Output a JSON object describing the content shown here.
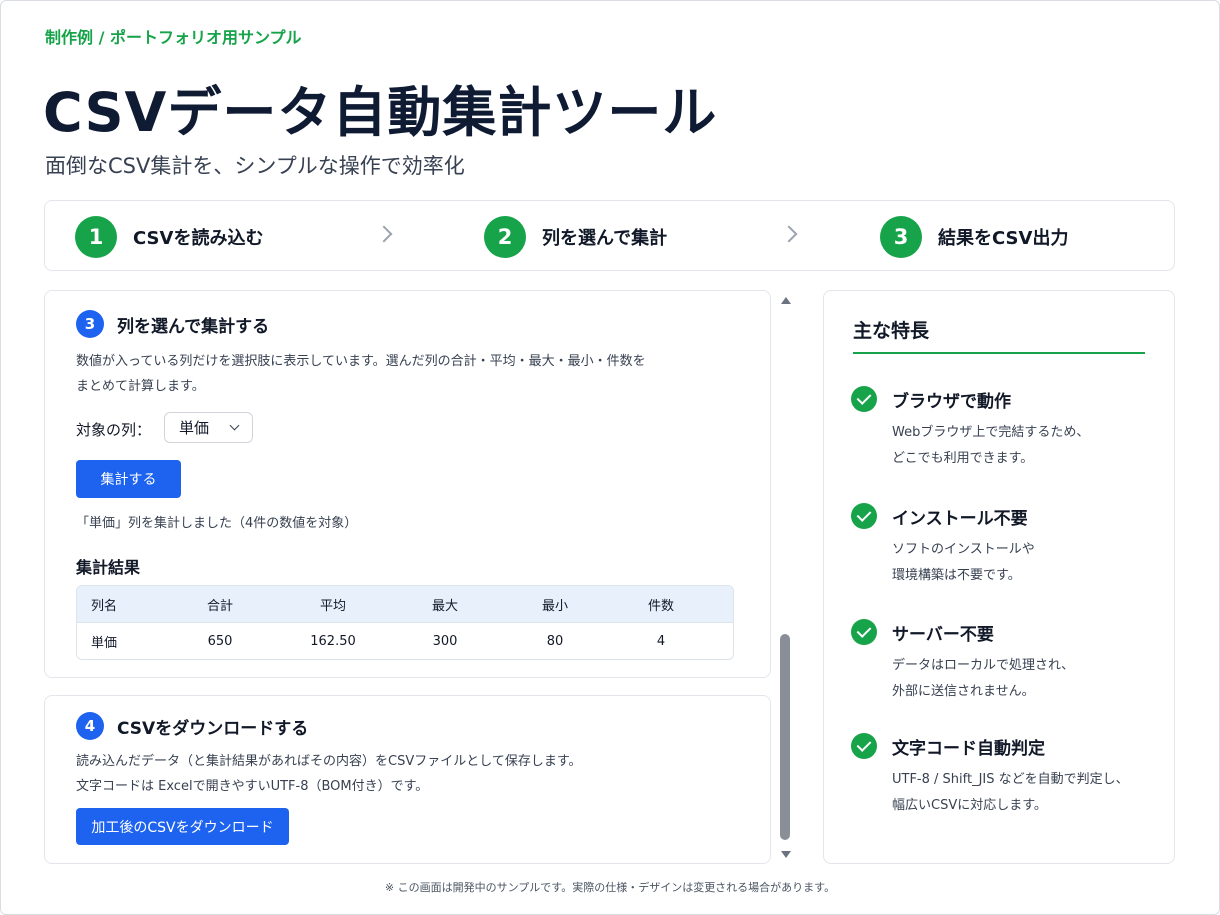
{
  "header": {
    "breadcrumb": "制作例 / ポートフォリオ用サンプル",
    "title": "CSVデータ自動集計ツール",
    "subtitle": "面倒なCSV集計を、シンプルな操作で効率化"
  },
  "steps": [
    {
      "num": "1",
      "label": "CSVを読み込む"
    },
    {
      "num": "2",
      "label": "列を選んで集計"
    },
    {
      "num": "3",
      "label": "結果をCSV出力"
    }
  ],
  "aggregate": {
    "num": "3",
    "title": "列を選んで集計する",
    "desc_line1": "数値が入っている列だけを選択肢に表示しています。選んだ列の合計・平均・最大・最小・件数を",
    "desc_line2": "まとめて計算します。",
    "column_label": "対象の列：",
    "column_value": "単価",
    "button": "集計する",
    "status": "「単価」列を集計しました（4件の数値を対象）",
    "result_title": "集計結果",
    "table": {
      "headers": [
        "列名",
        "合計",
        "平均",
        "最大",
        "最小",
        "件数"
      ],
      "row": [
        "単価",
        "650",
        "162.50",
        "300",
        "80",
        "4"
      ]
    }
  },
  "download": {
    "num": "4",
    "title": "CSVをダウンロードする",
    "desc_line1": "読み込んだデータ（と集計結果があればその内容）をCSVファイルとして保存します。",
    "desc_line2": "文字コードは Excelで開きやすいUTF-8（BOM付き）です。",
    "button": "加工後のCSVをダウンロード"
  },
  "features": {
    "title": "主な特長",
    "items": [
      {
        "name": "ブラウザで動作",
        "desc1": "Webブラウザ上で完結するため、",
        "desc2": "どこでも利用できます。"
      },
      {
        "name": "インストール不要",
        "desc1": "ソフトのインストールや",
        "desc2": "環境構築は不要です。"
      },
      {
        "name": "サーバー不要",
        "desc1": "データはローカルで処理され、",
        "desc2": "外部に送信されません。"
      },
      {
        "name": "文字コード自動判定",
        "desc1": "UTF-8 / Shift_JIS などを自動で判定し、",
        "desc2": "幅広いCSVに対応します。"
      }
    ]
  },
  "footnote": "※ この画面は開発中のサンプルです。実際の仕様・デザインは変更される場合があります。",
  "colors": {
    "accent_green": "#16a34a",
    "accent_blue": "#1d63f0",
    "title_navy": "#0f1a33"
  }
}
